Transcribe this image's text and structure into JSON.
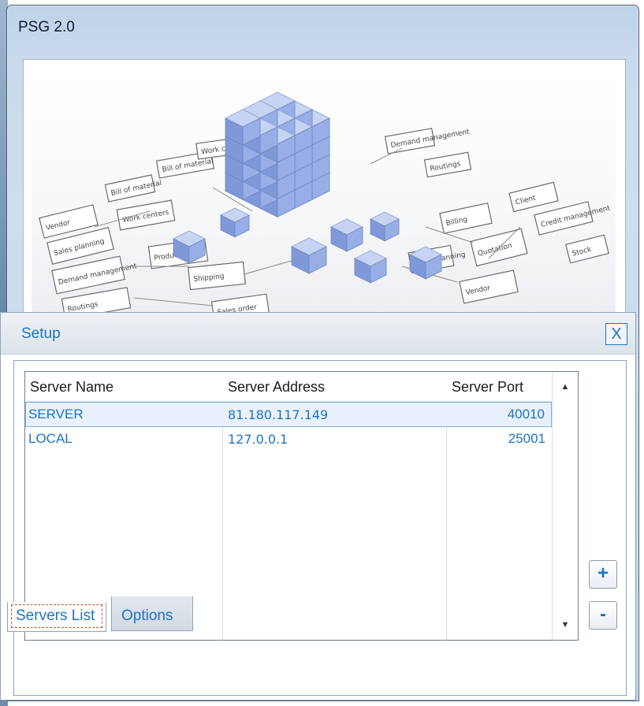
{
  "window": {
    "title": "PSG 2.0"
  },
  "banner": {
    "cube_color": "#7f99d8",
    "diagram_labels": [
      "Vendor",
      "Sales planning",
      "Demand management",
      "Routings",
      "Bill of material",
      "Work centers",
      "Product cost",
      "Shipping",
      "Sales order",
      "Billing",
      "Quotation",
      "Client",
      "Credit management",
      "Stock"
    ]
  },
  "setup": {
    "title": "Setup",
    "close_label": "X",
    "columns": [
      "Server Name",
      "Server Address",
      "Server Port"
    ],
    "rows": [
      {
        "name": "SERVER",
        "address": "81.180.117.149",
        "port": "40010",
        "selected": true
      },
      {
        "name": "LOCAL",
        "address": "127.0.0.1",
        "port": "25001",
        "selected": false
      }
    ],
    "add_label": "+",
    "remove_label": "-",
    "tabs": [
      "Servers List",
      "Options"
    ],
    "active_tab": "Servers List",
    "accent_color": "#1d74c2"
  }
}
